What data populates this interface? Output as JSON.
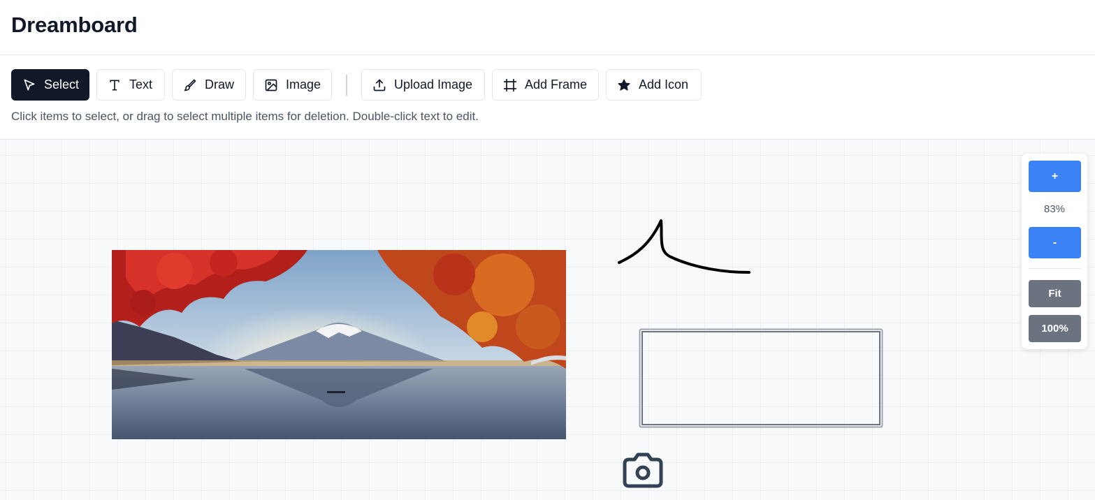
{
  "app": {
    "title": "Dreamboard"
  },
  "toolbar": {
    "tools": [
      {
        "label": "Select",
        "icon": "cursor-arrow-icon",
        "active": true
      },
      {
        "label": "Text",
        "icon": "text-icon",
        "active": false
      },
      {
        "label": "Draw",
        "icon": "brush-icon",
        "active": false
      },
      {
        "label": "Image",
        "icon": "image-icon",
        "active": false
      }
    ],
    "actions": [
      {
        "label": "Upload Image",
        "icon": "upload-icon"
      },
      {
        "label": "Add Frame",
        "icon": "frame-icon"
      },
      {
        "label": "Add Icon",
        "icon": "star-icon"
      }
    ],
    "hint": "Click items to select, or drag to select multiple items for deletion. Double-click text to edit."
  },
  "canvas": {
    "items": [
      {
        "type": "image",
        "subject": "mount-fuji-autumn-photo"
      },
      {
        "type": "drawing",
        "subject": "freehand-stroke"
      },
      {
        "type": "frame",
        "subject": "empty-frame"
      },
      {
        "type": "icon",
        "subject": "camera-icon"
      }
    ]
  },
  "zoom": {
    "zoom_in_label": "+",
    "level": "83%",
    "zoom_out_label": "-",
    "fit_label": "Fit",
    "reset_label": "100%"
  },
  "colors": {
    "active_tool": "#111827",
    "zoom_button": "#3b82f6",
    "secondary_button": "#6b7280",
    "canvas_bg": "#f8f9fb"
  }
}
